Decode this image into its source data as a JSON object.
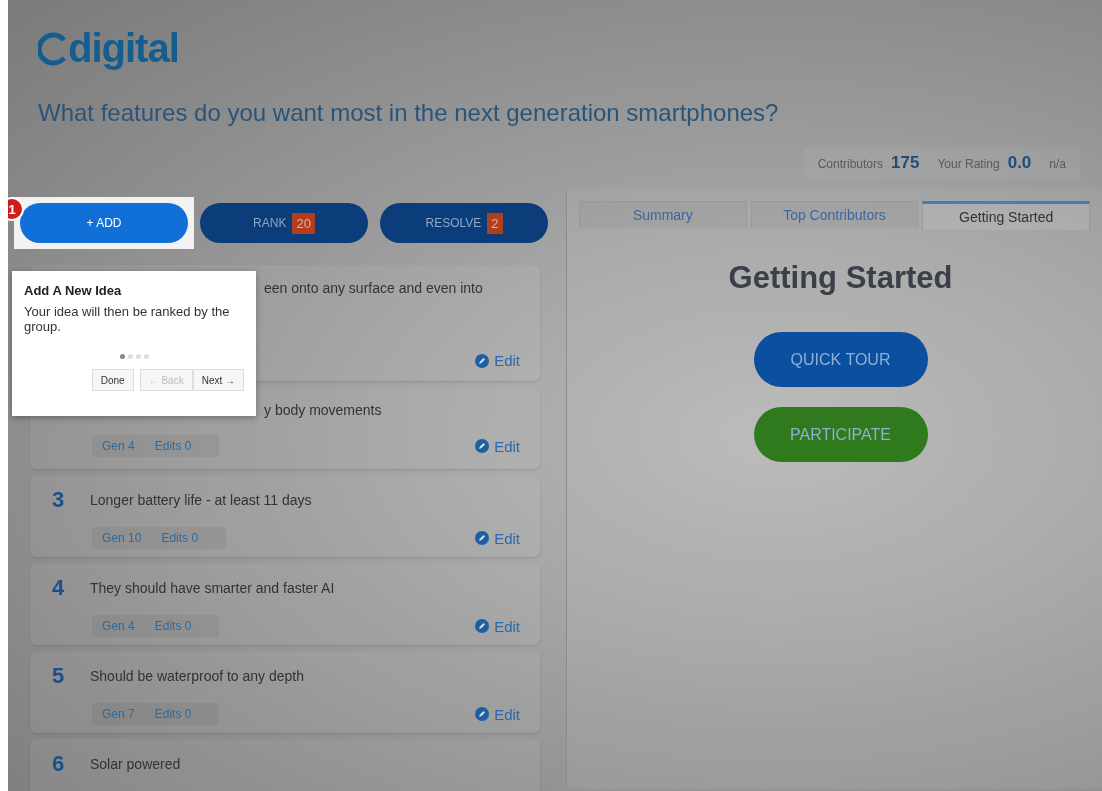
{
  "logo": {
    "text": "digital"
  },
  "question": "What features do you want most in the next generation smartphones?",
  "stats": [
    {
      "label": "Contributors",
      "value": "175"
    },
    {
      "label": "Your Rating",
      "value": "0.0",
      "note": "n/a"
    }
  ],
  "actions": [
    {
      "kind": "add",
      "label": "+ ADD",
      "highlighted": true
    },
    {
      "kind": "count",
      "label": "RANK",
      "count": "20",
      "highlighted": false
    },
    {
      "kind": "count",
      "label": "RESOLVE",
      "count": "2",
      "highlighted": false
    }
  ],
  "ideas": [
    {
      "text": "een onto any surface and even into",
      "covered": true,
      "edit": "Edit"
    },
    {
      "text": "y body movements",
      "covered": true,
      "gen": "Gen 4",
      "edits": "Edits 0",
      "edit": "Edit"
    },
    {
      "rank": "3",
      "text": "Longer battery life - at least 11 days",
      "gen": "Gen 10",
      "edits": "Edits 0",
      "edit": "Edit"
    },
    {
      "rank": "4",
      "text": "They should have smarter and faster AI",
      "gen": "Gen 4",
      "edits": "Edits 0",
      "edit": "Edit"
    },
    {
      "rank": "5",
      "text": "Should be waterproof to any depth",
      "gen": "Gen 7",
      "edits": "Edits 0",
      "edit": "Edit"
    },
    {
      "rank": "6",
      "text": "Solar powered"
    }
  ],
  "tour": {
    "step": "1",
    "title": "Add A New Idea",
    "body": "Your idea will then be ranked by the group.",
    "dots": [
      {
        "selected": true
      },
      {
        "selected": false
      },
      {
        "selected": false
      },
      {
        "selected": false
      }
    ],
    "buttons": [
      {
        "label": "Done",
        "disabled": false
      },
      {
        "label": "← Back",
        "disabled": true
      },
      {
        "label": "Next →",
        "disabled": false
      }
    ]
  },
  "tabs": [
    {
      "label": "Summary",
      "selected": false
    },
    {
      "label": "Top Contributors",
      "selected": false
    },
    {
      "label": "Getting Started",
      "selected": true
    }
  ],
  "panel": {
    "heading": "Getting Started",
    "buttons": [
      {
        "label": "QUICK TOUR",
        "color": "#0b4fa0"
      },
      {
        "label": "PARTICIPATE",
        "color": "#2f7a1c"
      }
    ]
  }
}
